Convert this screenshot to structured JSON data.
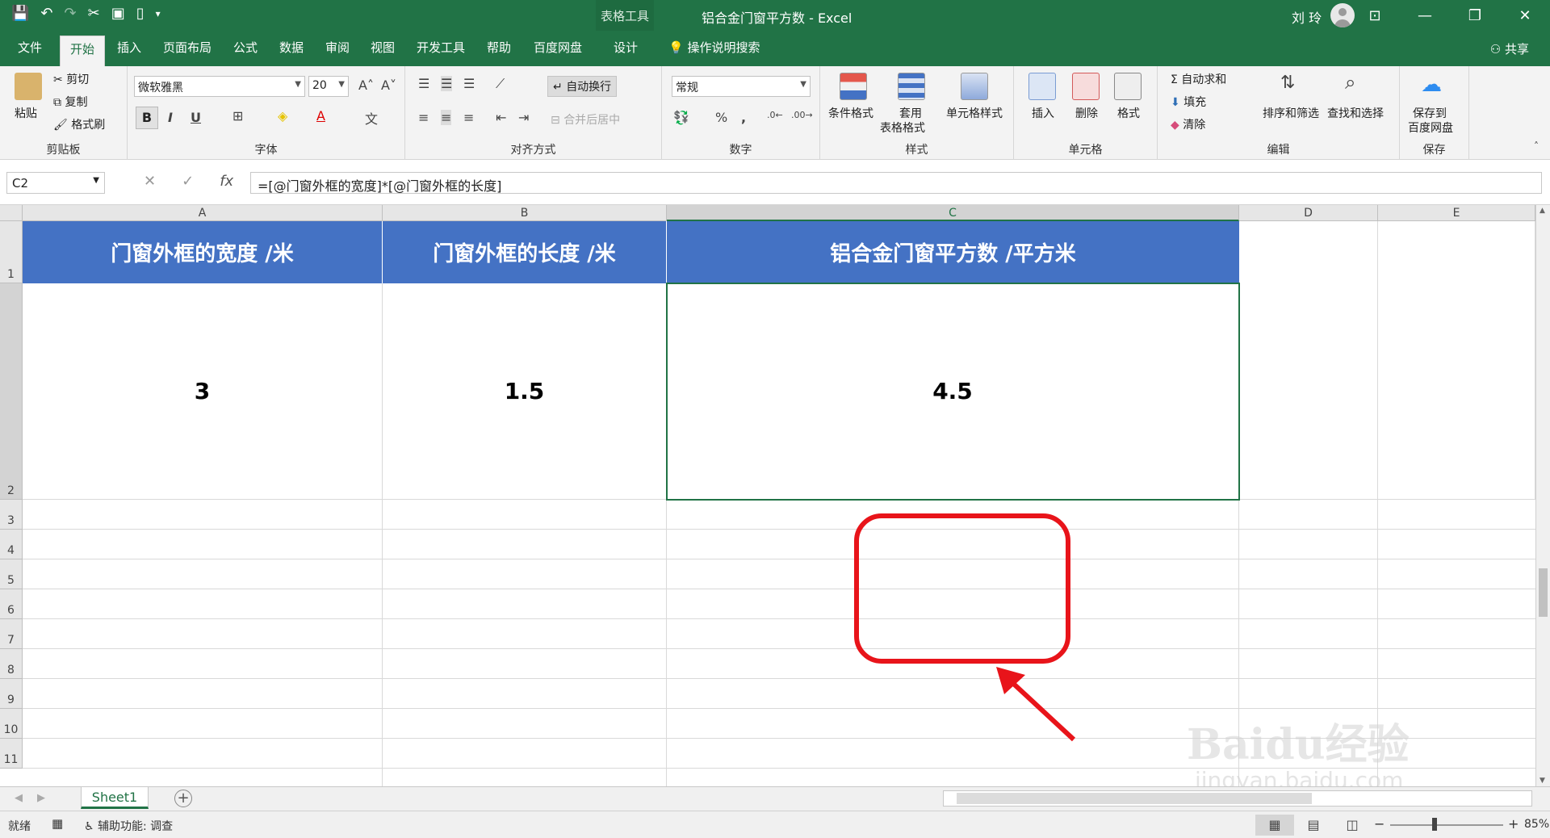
{
  "window": {
    "title": "铝合金门窗平方数  -  Excel",
    "context_tab_title": "表格工具",
    "user": "刘 玲",
    "qat": [
      "save-icon",
      "undo-icon",
      "redo-icon",
      "cut-icon",
      "preview-icon",
      "new-icon"
    ]
  },
  "ribbon_tabs": {
    "file": "文件",
    "home": "开始",
    "insert": "插入",
    "layout": "页面布局",
    "formulas": "公式",
    "data": "数据",
    "review": "审阅",
    "view": "视图",
    "dev": "开发工具",
    "help": "帮助",
    "baidu": "百度网盘",
    "design": "设计",
    "search": "操作说明搜索",
    "share": "共享"
  },
  "ribbon": {
    "clipboard": {
      "label": "剪贴板",
      "paste": "粘贴",
      "cut": "剪切",
      "copy": "复制",
      "format_painter": "格式刷"
    },
    "font": {
      "label": "字体",
      "name": "微软雅黑",
      "size": "20",
      "bold": "B",
      "italic": "I",
      "underline": "U"
    },
    "alignment": {
      "label": "对齐方式",
      "wrap": "自动换行",
      "merge": "合并后居中"
    },
    "number": {
      "label": "数字",
      "format": "常规",
      "percent": "%",
      "comma": ","
    },
    "styles": {
      "label": "样式",
      "cond": "条件格式",
      "table_1": "套用",
      "table_2": "表格格式",
      "cell": "单元格样式"
    },
    "cells": {
      "label": "单元格",
      "insert": "插入",
      "delete": "删除",
      "format": "格式"
    },
    "editing": {
      "label": "编辑",
      "autosum": "自动求和",
      "fill": "填充",
      "clear": "清除",
      "sort": "排序和筛选",
      "find": "查找和选择"
    },
    "save": {
      "label": "保存",
      "save_to_1": "保存到",
      "save_to_2": "百度网盘"
    }
  },
  "formula_bar": {
    "name_box": "C2",
    "formula": "=[@门窗外框的宽度]*[@门窗外框的长度]"
  },
  "sheet": {
    "columns": [
      "A",
      "B",
      "C",
      "D",
      "E"
    ],
    "rows": [
      "1",
      "2",
      "3",
      "4",
      "5",
      "6",
      "7",
      "8",
      "9",
      "10",
      "11"
    ],
    "headers": [
      "门窗外框的宽度 /米",
      "门窗外框的长度 /米",
      "铝合金门窗平方数 /平方米"
    ],
    "values": [
      "3",
      "1.5",
      "4.5"
    ],
    "header_color": "#4472c4",
    "highlight_color": "#e8141a"
  },
  "sheet_tabs": {
    "active": "Sheet1"
  },
  "status": {
    "ready": "就绪",
    "accessibility": "辅助功能: 调查",
    "zoom": "85%"
  },
  "watermark": {
    "logo": "Baidu经验",
    "url": "jingyan.baidu.com"
  }
}
